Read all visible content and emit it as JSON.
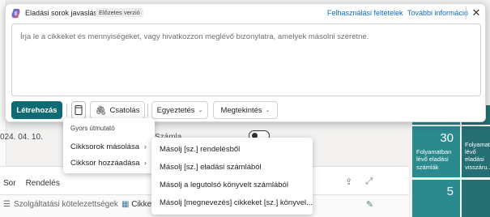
{
  "dialog": {
    "title": "Eladási sorok javaslása",
    "badge": "Előzetes verzió",
    "terms_link": "Felhasználási feltételek",
    "info_link": "További információ",
    "close_glyph": "✕"
  },
  "prompt": {
    "placeholder": "Írja le a cikkeket és mennyiségeket, vagy hivatkozzon meglévő bizonylatra, amelyek másolni szeretne."
  },
  "toolbar": {
    "generate_label": "Létrehozás",
    "attach_label": "Csatolás",
    "match_label": "Egyeztetés",
    "view_label": "Megtekintés"
  },
  "menu": {
    "heading": "Gyors útmutató",
    "items": [
      {
        "label": "Cikksorok másolása"
      },
      {
        "label": "Cikksor hozzáadása"
      }
    ]
  },
  "submenu": {
    "items": [
      {
        "label": "Másolj [sz.] rendelésből"
      },
      {
        "label": "Másolj [sz.] eladási számlából"
      },
      {
        "label": "Másolj a legutolsó könyvelt számlából"
      },
      {
        "label": "Másolj [megnevezés] cikkeket [sz.] könyvel..."
      }
    ]
  },
  "background": {
    "date": "024. 04. 10.",
    "szamla": "Számla",
    "tabs": [
      "Sor",
      "Rendelés"
    ],
    "service_label": "Szolgáltatási kötelezettségek",
    "cikke": "Cikke",
    "tiles": [
      {
        "number": "30",
        "label": "Folyamatban lévő eladási számlák"
      },
      {
        "number": "",
        "label": "Folyamatban lévő eladási visszáru..."
      },
      {
        "number": "5",
        "label": ""
      },
      {
        "number": "",
        "label": "... lévő ... ..."
      }
    ]
  },
  "colors": {
    "primary": "#0f6b73",
    "link": "#0f6cbd",
    "tile": "#2a8a8e"
  }
}
